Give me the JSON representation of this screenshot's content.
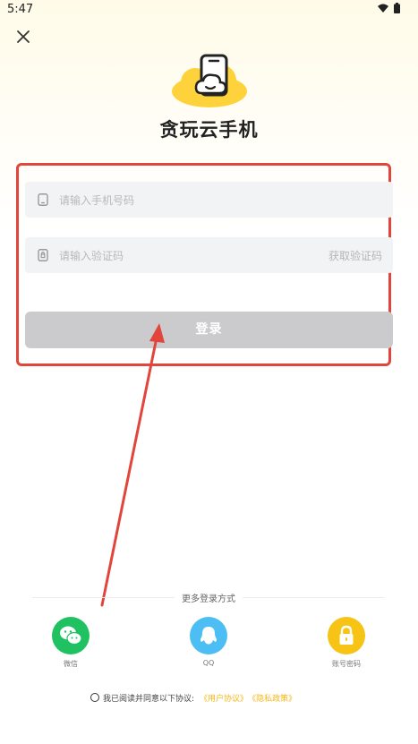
{
  "status_bar": {
    "time": "5:47"
  },
  "header": {
    "app_name": "贪玩云手机"
  },
  "form": {
    "phone_placeholder": "请输入手机号码",
    "phone_value": "",
    "code_placeholder": "请输入验证码",
    "code_value": "",
    "get_code_label": "获取验证码",
    "login_label": "登录",
    "login_button_color": "#cbcbcd"
  },
  "more_login": {
    "title": "更多登录方式",
    "options": [
      {
        "label": "微信",
        "icon": "wechat-icon",
        "color": "#1fc160"
      },
      {
        "label": "QQ",
        "icon": "qq-icon",
        "color": "#4dbef3"
      },
      {
        "label": "账号密码",
        "icon": "lock-icon",
        "color": "#f7c314"
      }
    ]
  },
  "agreement": {
    "text": "我已阅读并同意以下协议:",
    "link_user": "《用户协议》",
    "link_privacy": "《隐私政策》",
    "link_color": "#f5b719"
  },
  "annotation": {
    "highlight_color": "#e2453c"
  },
  "theme": {
    "accent": "#f7c314",
    "brand_yellow": "#fdd23a"
  }
}
